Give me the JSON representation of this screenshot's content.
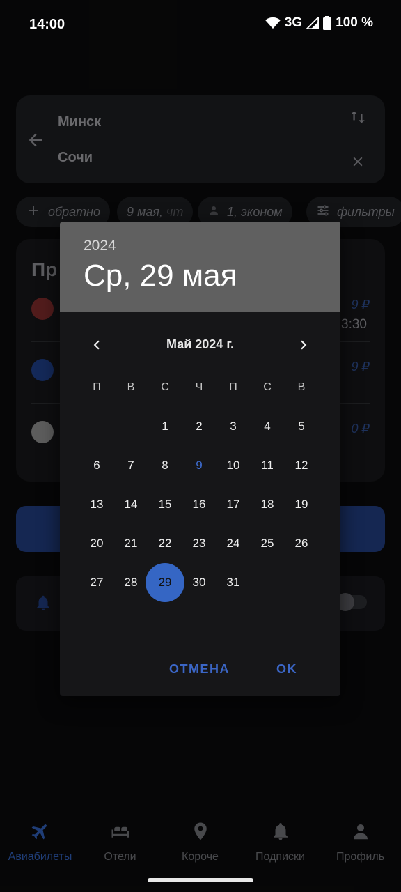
{
  "status": {
    "time": "14:00",
    "network": "3G",
    "battery": "100 %"
  },
  "search": {
    "from": "Минск",
    "to": "Сочи"
  },
  "chips": [
    {
      "label": "обратно"
    },
    {
      "label": "9 мая,",
      "muted": "чт"
    },
    {
      "label": "1, эконом"
    },
    {
      "label": "фильтры"
    }
  ],
  "list": {
    "heading": "Пр",
    "prices": [
      "9 ₽",
      "9 ₽",
      "0 ₽"
    ],
    "time": "3:30",
    "colors": [
      "#7a2a2a",
      "#1e3d84",
      "#8a8a8a"
    ]
  },
  "nav": {
    "items": [
      {
        "label": "Авиабилеты",
        "icon": "plane-icon"
      },
      {
        "label": "Отели",
        "icon": "bed-icon"
      },
      {
        "label": "Короче",
        "icon": "location-pin-icon"
      },
      {
        "label": "Подписки",
        "icon": "bell-icon"
      },
      {
        "label": "Профиль",
        "icon": "person-icon"
      }
    ]
  },
  "dialog": {
    "year": "2024",
    "selected_date": "Ср, 29 мая",
    "month_title": "Май 2024 г.",
    "weekdays": [
      "П",
      "В",
      "С",
      "Ч",
      "П",
      "С",
      "В"
    ],
    "days": [
      "1",
      "2",
      "3",
      "4",
      "5",
      "6",
      "7",
      "8",
      "9",
      "10",
      "11",
      "12",
      "13",
      "14",
      "15",
      "16",
      "17",
      "18",
      "19",
      "20",
      "21",
      "22",
      "23",
      "24",
      "25",
      "26",
      "27",
      "28",
      "29",
      "30",
      "31"
    ],
    "today": "9",
    "selected": "29",
    "cancel": "ОТМЕНА",
    "ok": "OK"
  },
  "colors": {
    "accent": "#3566c4",
    "header": "#606060",
    "dialog_bg": "#161618"
  }
}
